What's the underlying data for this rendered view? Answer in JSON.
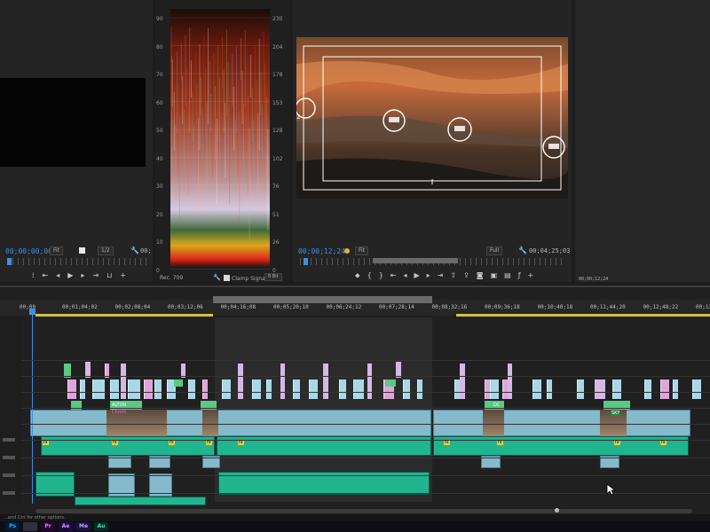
{
  "source": {
    "timecode": "00;00;00;00",
    "fit": "Fit",
    "ratio": "1/2",
    "end_tc": "00;"
  },
  "scope": {
    "left_scale": [
      "90",
      "80",
      "70",
      "60",
      "50",
      "40",
      "30",
      "20",
      "10",
      "0"
    ],
    "right_scale": [
      "230",
      "204",
      "178",
      "153",
      "128",
      "102",
      "76",
      "51",
      "26",
      "0"
    ],
    "standard": "Rec. 709",
    "clamp_label": "Clamp Signal",
    "bit_depth": "8 Bit"
  },
  "program": {
    "timecode": "00;00;12;24",
    "fit": "Fit",
    "quality": "Full",
    "duration": "00;04;25;03",
    "marker": "2"
  },
  "right_panel": {
    "timecode": "00;00;12;24"
  },
  "timeline": {
    "playhead_tc": "00;00",
    "ruler_labels": [
      "00;01;04;02",
      "00;02;08;04",
      "00;03;12;06",
      "00;04;16;08",
      "00;05;20;10",
      "00;06;24;12",
      "00;07;28;14",
      "00;08;32;16",
      "00;09;36;18",
      "00;10;40;18",
      "00;11;44;20",
      "00;12;48;22",
      "00;13"
    ],
    "clip_labels": [
      "ALTON",
      "Chrom",
      "DC",
      "SKY"
    ],
    "fx_badge": "fx"
  },
  "status": {
    "hint": "...and Ctrl for other options."
  },
  "taskbar": {
    "apps": [
      {
        "label": "Ps",
        "color": "#31a8ff",
        "bg": "#001e36"
      },
      {
        "label": "",
        "color": "#cccccc",
        "bg": "#303040"
      },
      {
        "label": "Pr",
        "color": "#ea77ff",
        "bg": "#2a0634"
      },
      {
        "label": "Ae",
        "color": "#d291ff",
        "bg": "#1f0a40"
      },
      {
        "label": "Me",
        "color": "#b6a7ff",
        "bg": "#1a1240"
      },
      {
        "label": "Au",
        "color": "#4ce0b3",
        "bg": "#062a22"
      }
    ]
  }
}
